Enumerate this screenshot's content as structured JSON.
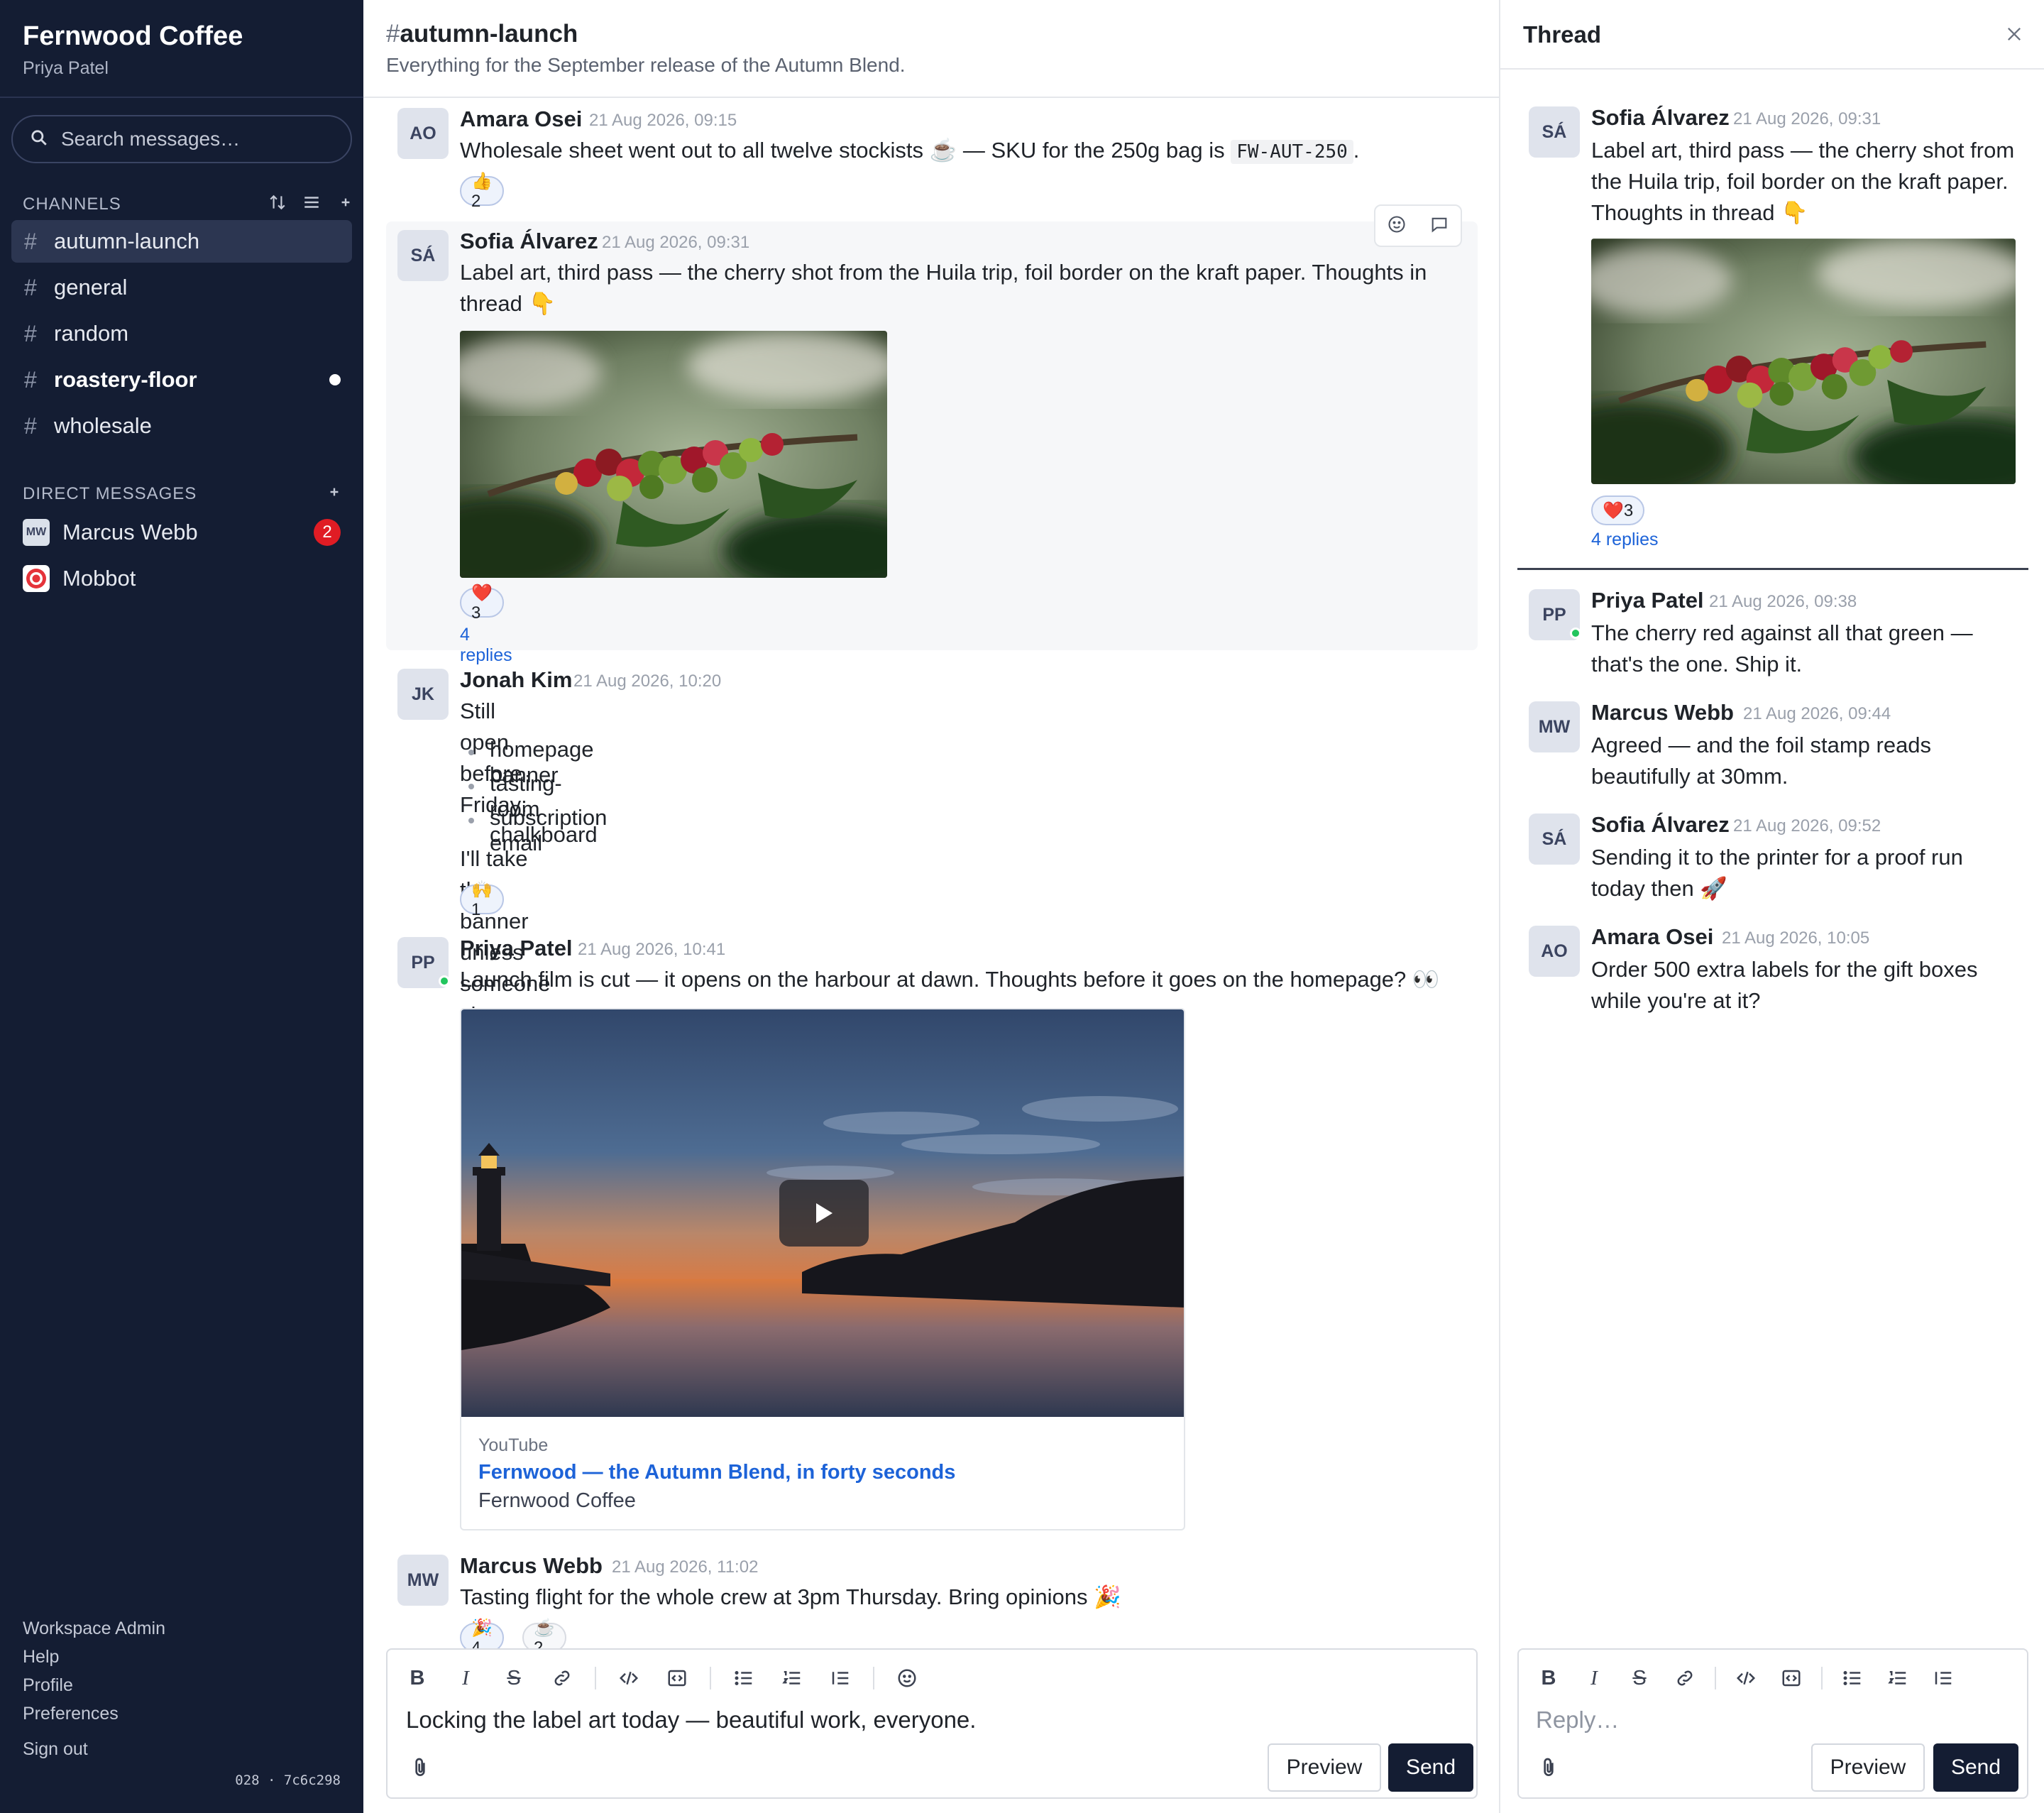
{
  "workspace": {
    "name": "Fernwood Coffee",
    "user": "Priya Patel"
  },
  "search": {
    "placeholder": "Search messages…"
  },
  "channels": {
    "heading": "CHANNELS",
    "items": [
      {
        "name": "autumn-launch",
        "active": true
      },
      {
        "name": "general"
      },
      {
        "name": "random"
      },
      {
        "name": "roastery-floor",
        "unread": true
      },
      {
        "name": "wholesale"
      }
    ]
  },
  "dms": {
    "heading": "DIRECT MESSAGES",
    "items": [
      {
        "name": "Marcus Webb",
        "initials": "MW",
        "badge": "2"
      },
      {
        "name": "Mobbot"
      }
    ]
  },
  "footer": {
    "links": [
      "Workspace Admin",
      "Help",
      "Profile",
      "Preferences",
      "Sign out"
    ],
    "version": "028 · 7c6c298"
  },
  "channel": {
    "hash": "#",
    "name": "autumn-launch",
    "description": "Everything for the September release of the Autumn Blend."
  },
  "messages": [
    {
      "initials": "AO",
      "author": "Amara Osei",
      "time": "21 Aug 2026, 09:15",
      "text_before": "Wholesale sheet went out to all twelve stockists ☕ — SKU for the 250g bag is",
      "code": "FW-AUT-250",
      "text_after": ".",
      "reaction": "👍2"
    },
    {
      "initials": "SÁ",
      "author": "Sofia Álvarez",
      "time": "21 Aug 2026, 09:31",
      "text": "Label art, third pass — the cherry shot from the Huila trip, foil border on the kraft paper. Thoughts in thread 👇",
      "reaction": "❤️3",
      "replies": "4 replies"
    },
    {
      "initials": "JK",
      "author": "Jonah Kim",
      "time": "21 Aug 2026, 10:20",
      "text": "Still open before Friday:",
      "list": [
        "homepage banner",
        "tasting-room chalkboard",
        "subscription email"
      ],
      "text2": "I'll take the banner unless someone shouts.",
      "reaction": "🙌1"
    },
    {
      "initials": "PP",
      "author": "Priya Patel",
      "time": "21 Aug 2026, 10:41",
      "text": "Launch film is cut — it opens on the harbour at dawn. Thoughts before it goes on the homepage? 👀",
      "video": {
        "provider": "YouTube",
        "title": "Fernwood — the Autumn Blend, in forty seconds",
        "author": "Fernwood Coffee"
      }
    },
    {
      "initials": "MW",
      "author": "Marcus Webb",
      "time": "21 Aug 2026, 11:02",
      "text": "Tasting flight for the whole crew at 3pm Thursday. Bring opinions 🎉",
      "reactions": [
        "🎉4",
        "☕2"
      ]
    }
  ],
  "composer": {
    "value": "Locking the label art today — beautiful work, everyone.",
    "preview": "Preview",
    "send": "Send"
  },
  "thread": {
    "title": "Thread",
    "root": {
      "initials": "SÁ",
      "author": "Sofia Álvarez",
      "time": "21 Aug 2026, 09:31",
      "text": "Label art, third pass — the cherry shot from the Huila trip, foil border on the kraft paper. Thoughts in thread 👇",
      "reaction": "❤️3",
      "replies": "4 replies"
    },
    "replies": [
      {
        "initials": "PP",
        "author": "Priya Patel",
        "time": "21 Aug 2026, 09:38",
        "text": "The cherry red against all that green — that's the one. Ship it."
      },
      {
        "initials": "MW",
        "author": "Marcus Webb",
        "time": "21 Aug 2026, 09:44",
        "text": "Agreed — and the foil stamp reads beautifully at 30mm."
      },
      {
        "initials": "SÁ",
        "author": "Sofia Álvarez",
        "time": "21 Aug 2026, 09:52",
        "text": "Sending it to the printer for a proof run today then 🚀"
      },
      {
        "initials": "AO",
        "author": "Amara Osei",
        "time": "21 Aug 2026, 10:05",
        "text": "Order 500 extra labels for the gift boxes while you're at it?"
      }
    ],
    "composer": {
      "placeholder": "Reply…",
      "preview": "Preview",
      "send": "Send"
    }
  }
}
